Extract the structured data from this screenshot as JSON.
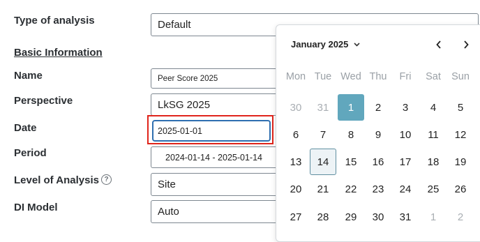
{
  "labels": {
    "type_of_analysis": "Type of analysis",
    "basic_information": "Basic Information",
    "name": "Name",
    "perspective": "Perspective",
    "date": "Date",
    "period": "Period",
    "level_of_analysis": "Level of Analysis",
    "di_model": "DI Model"
  },
  "fields": {
    "type_of_analysis": "Default",
    "name": "Peer Score 2025",
    "perspective": "LkSG 2025",
    "date": "2025-01-01",
    "period": "2024-01-14 - 2025-01-14",
    "level_of_analysis": "Site",
    "di_model": "Auto"
  },
  "help_icon": "?",
  "calendar": {
    "month_label": "January 2025",
    "weekdays": [
      "Mon",
      "Tue",
      "Wed",
      "Thu",
      "Fri",
      "Sat",
      "Sun"
    ],
    "weeks": [
      [
        "30",
        "31",
        "1",
        "2",
        "3",
        "4",
        "5"
      ],
      [
        "6",
        "7",
        "8",
        "9",
        "10",
        "11",
        "12"
      ],
      [
        "13",
        "14",
        "15",
        "16",
        "17",
        "18",
        "19"
      ],
      [
        "20",
        "21",
        "22",
        "23",
        "24",
        "25",
        "26"
      ],
      [
        "27",
        "28",
        "29",
        "30",
        "31",
        "1",
        "2"
      ]
    ],
    "outside_month": [
      [
        0,
        0
      ],
      [
        0,
        1
      ],
      [
        4,
        5
      ],
      [
        4,
        6
      ]
    ],
    "selected": [
      0,
      2
    ],
    "today": [
      2,
      1
    ]
  },
  "colors": {
    "selected": "#61a7bd",
    "highlight": "#e0241b",
    "focus": "#2f6fb0"
  }
}
